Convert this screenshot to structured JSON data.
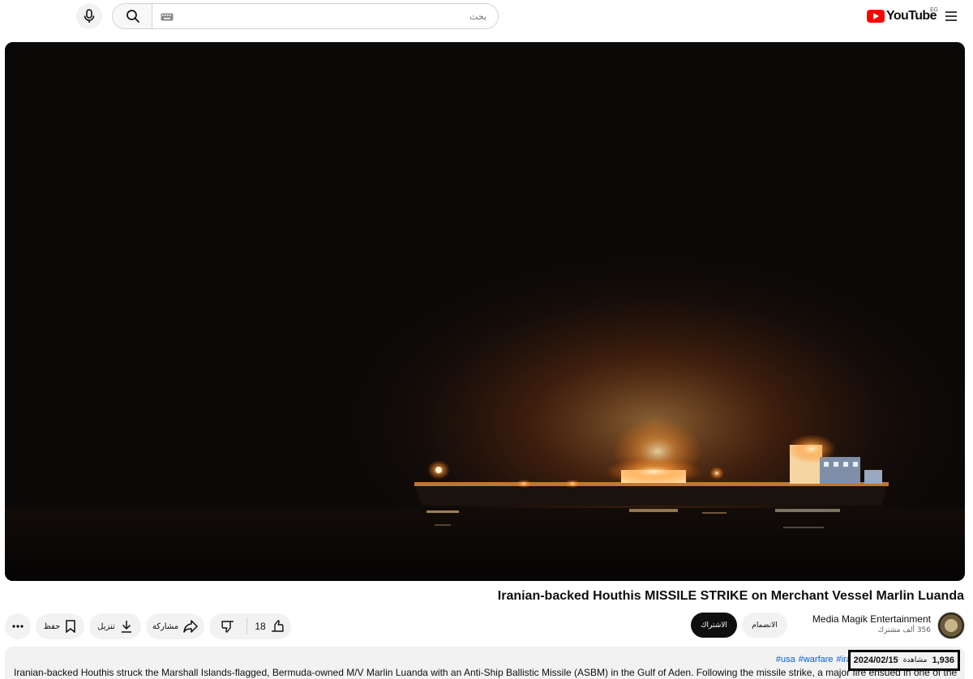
{
  "header": {
    "search_placeholder": "بحث",
    "logo_text": "YouTube",
    "region_code": "EG",
    "icons": {
      "mic": "microphone-icon",
      "search": "search-icon",
      "keyboard": "keyboard-icon",
      "menu": "hamburger-menu-icon"
    }
  },
  "video": {
    "title": "Iranian-backed Houthis MISSILE STRIKE on Merchant Vessel Marlin Luanda"
  },
  "channel": {
    "name": "Media Magik Entertainment",
    "subscribers": "356 ألف مشترك",
    "subscribe_label": "الاشتراك",
    "join_label": "الانضمام"
  },
  "actions": {
    "like_count": "18",
    "share_label": "مشاركة",
    "download_label": "تنزيل",
    "save_label": "حفظ",
    "icons": {
      "like": "thumbs-up-icon",
      "dislike": "thumbs-down-icon",
      "share": "share-icon",
      "download": "download-icon",
      "save": "bookmark-icon",
      "more": "more-horizontal-icon"
    }
  },
  "description": {
    "views": "1,936",
    "views_label": "مشاهدة",
    "date": "2024/02/15",
    "hashtags": [
      "#usa",
      "#warfare",
      "#iran"
    ],
    "text": "Iranian-backed Houthis struck the Marshall Islands-flagged, Bermuda-owned M/V Marlin Luanda with an Anti-Ship Ballistic Missile (ASBM) in the Gulf of Aden. Following the missile strike, a major fire ensued in one of the cargo holds. USS"
  },
  "colors": {
    "brand_red": "#ff0000",
    "button_bg": "#f2f2f2",
    "subscribe_bg": "#0f0f0f",
    "hashtag_blue": "#065fd4"
  }
}
